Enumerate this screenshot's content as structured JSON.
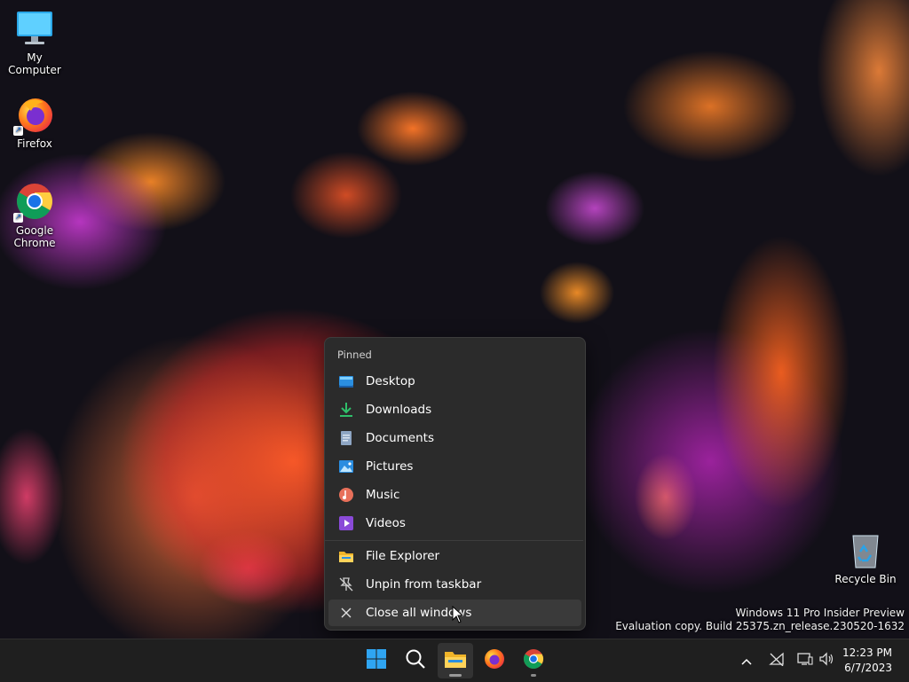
{
  "desktop": {
    "icons": [
      {
        "label": "My Computer",
        "icon": "monitor-icon"
      },
      {
        "label": "Firefox",
        "icon": "firefox-icon"
      },
      {
        "label": "Google Chrome",
        "icon": "chrome-icon"
      },
      {
        "label": "Recycle Bin",
        "icon": "recycle-bin-icon"
      }
    ],
    "watermark": {
      "line1": "Windows 11 Pro Insider Preview",
      "line2": "Evaluation copy. Build 25375.zn_release.230520-1632"
    }
  },
  "jumplist": {
    "section_label": "Pinned",
    "pinned": [
      {
        "label": "Desktop",
        "icon": "desktop-folder-icon"
      },
      {
        "label": "Downloads",
        "icon": "downloads-icon"
      },
      {
        "label": "Documents",
        "icon": "documents-icon"
      },
      {
        "label": "Pictures",
        "icon": "pictures-icon"
      },
      {
        "label": "Music",
        "icon": "music-icon"
      },
      {
        "label": "Videos",
        "icon": "videos-icon"
      }
    ],
    "actions": [
      {
        "label": "File Explorer",
        "icon": "file-explorer-icon"
      },
      {
        "label": "Unpin from taskbar",
        "icon": "unpin-icon"
      },
      {
        "label": "Close all windows",
        "icon": "close-icon"
      }
    ]
  },
  "taskbar": {
    "apps": [
      {
        "name": "Start",
        "icon": "windows-start-icon"
      },
      {
        "name": "Search",
        "icon": "search-icon"
      },
      {
        "name": "File Explorer",
        "icon": "file-explorer-icon",
        "active": true
      },
      {
        "name": "Firefox",
        "icon": "firefox-icon"
      },
      {
        "name": "Google Chrome",
        "icon": "chrome-icon"
      }
    ],
    "tray_icons": [
      "chevron-up-icon",
      "network-disconnected-icon",
      "display-icon",
      "volume-icon"
    ],
    "clock": {
      "time": "12:23 PM",
      "date": "6/7/2023"
    }
  },
  "colors": {
    "menu_bg": "#2b2b2b",
    "taskbar_bg": "#1f1f1f",
    "accent_blue": "#0a7de0"
  }
}
